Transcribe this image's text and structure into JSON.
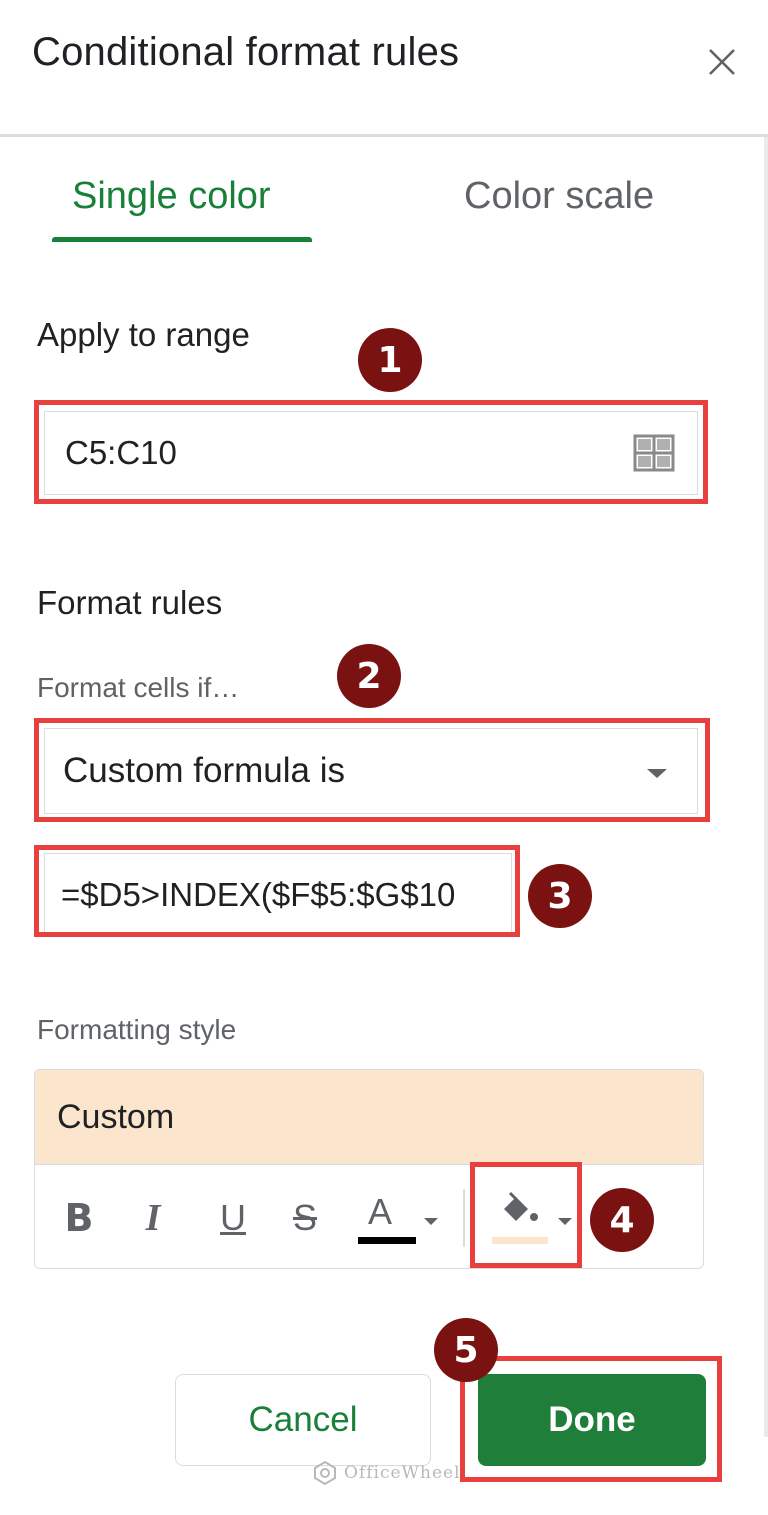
{
  "header": {
    "title": "Conditional format rules",
    "close_icon": "close-icon"
  },
  "tabs": [
    {
      "label": "Single color",
      "active": true
    },
    {
      "label": "Color scale",
      "active": false
    }
  ],
  "apply_range": {
    "label": "Apply to range",
    "value": "C5:C10",
    "icon": "grid-icon"
  },
  "format_rules": {
    "label": "Format rules",
    "condition_label": "Format cells if…",
    "condition_value": "Custom formula is",
    "formula_value": "=$D5>INDEX($F$5:$G$10"
  },
  "formatting_style": {
    "label": "Formatting style",
    "preview_label": "Custom",
    "preview_color": "#fce5cd",
    "toolbar": {
      "bold": "B",
      "italic": "I",
      "underline": "U",
      "strikethrough": "S",
      "text_color": "A"
    },
    "text_color_swatch": "#000000",
    "fill_color_swatch": "#fce5cd"
  },
  "buttons": {
    "cancel": "Cancel",
    "done": "Done"
  },
  "badges": [
    "1",
    "2",
    "3",
    "4",
    "5"
  ],
  "colors": {
    "accent_green": "#188038",
    "done_green": "#1e7e3a",
    "highlight_red": "#e8403f",
    "badge_maroon": "#7b1212"
  },
  "watermark": {
    "text": "OfficeWheel"
  }
}
